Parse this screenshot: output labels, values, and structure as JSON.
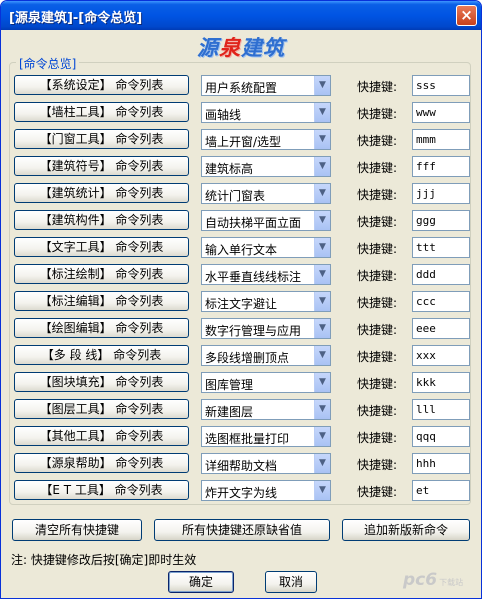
{
  "window": {
    "title": "[源泉建筑]-[命令总览]",
    "close_glyph": "×"
  },
  "logo": {
    "part1": "源",
    "part2": "泉",
    "part3": "建筑"
  },
  "group": {
    "label": "[命令总览]"
  },
  "hotkey_label": "快捷键:",
  "rows": [
    {
      "button": "【系统设定】 命令列表",
      "selected": "用户系统配置",
      "hotkey": "sss"
    },
    {
      "button": "【墙柱工具】 命令列表",
      "selected": "画轴线",
      "hotkey": "www"
    },
    {
      "button": "【门窗工具】 命令列表",
      "selected": "墙上开窗/选型",
      "hotkey": "mmm"
    },
    {
      "button": "【建筑符号】 命令列表",
      "selected": "建筑标高",
      "hotkey": "fff"
    },
    {
      "button": "【建筑统计】 命令列表",
      "selected": "统计门窗表",
      "hotkey": "jjj"
    },
    {
      "button": "【建筑构件】 命令列表",
      "selected": "自动扶梯平面立面",
      "hotkey": "ggg"
    },
    {
      "button": "【文字工具】 命令列表",
      "selected": "输入单行文本",
      "hotkey": "ttt"
    },
    {
      "button": "【标注绘制】 命令列表",
      "selected": "水平垂直线线标注",
      "hotkey": "ddd"
    },
    {
      "button": "【标注编辑】 命令列表",
      "selected": "标注文字避让",
      "hotkey": "ccc"
    },
    {
      "button": "【绘图编辑】 命令列表",
      "selected": "数字行管理与应用",
      "hotkey": "eee"
    },
    {
      "button": "【多 段 线】 命令列表",
      "selected": "多段线增删顶点",
      "hotkey": "xxx"
    },
    {
      "button": "【图块填充】 命令列表",
      "selected": "图库管理",
      "hotkey": "kkk"
    },
    {
      "button": "【图层工具】 命令列表",
      "selected": "新建图层",
      "hotkey": "lll"
    },
    {
      "button": "【其他工具】 命令列表",
      "selected": "选图框批量打印",
      "hotkey": "qqq"
    },
    {
      "button": "【源泉帮助】 命令列表",
      "selected": "详细帮助文档",
      "hotkey": "hhh"
    },
    {
      "button": "【E T 工具】 命令列表",
      "selected": "炸开文字为线",
      "hotkey": "et"
    }
  ],
  "actions": {
    "clear_all": "清空所有快捷键",
    "restore_defaults": "所有快捷键还原缺省值",
    "append_new": "追加新版新命令"
  },
  "note": "注: 快捷键修改后按[确定]即时生效",
  "ok": "确定",
  "cancel": "取消",
  "watermark": {
    "main": "pc6",
    "sub": "下载站"
  },
  "icons": {
    "dropdown": "▼"
  }
}
